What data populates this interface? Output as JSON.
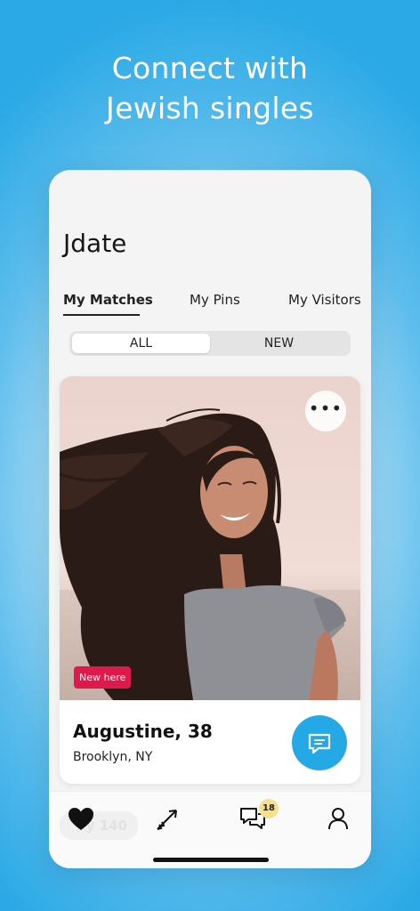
{
  "headline": {
    "line1": "Connect with",
    "line2": "Jewish singles"
  },
  "app": {
    "title": "Jdate"
  },
  "tabs": [
    {
      "label": "My Matches",
      "active": true
    },
    {
      "label": "My Pins",
      "active": false
    },
    {
      "label": "My Visitors",
      "active": false
    }
  ],
  "segment": {
    "all": "ALL",
    "new": "NEW",
    "selected": "ALL"
  },
  "profile": {
    "badge": "New here",
    "name": "Augustine, 38",
    "location": "Brooklyn, NY",
    "more_icon": "more-horizontal-icon",
    "chat_icon": "chat-icon"
  },
  "nav": {
    "ghost_text": "y 140",
    "items": [
      {
        "icon": "heart-icon",
        "active": true
      },
      {
        "icon": "arrow-icon"
      },
      {
        "icon": "messages-icon",
        "badge": "18"
      },
      {
        "icon": "profile-icon"
      }
    ]
  },
  "colors": {
    "background": "#2aa9e6",
    "accent": "#24a9e6",
    "badge_new": "#e0194d",
    "badge_count": "#f7e08c"
  }
}
